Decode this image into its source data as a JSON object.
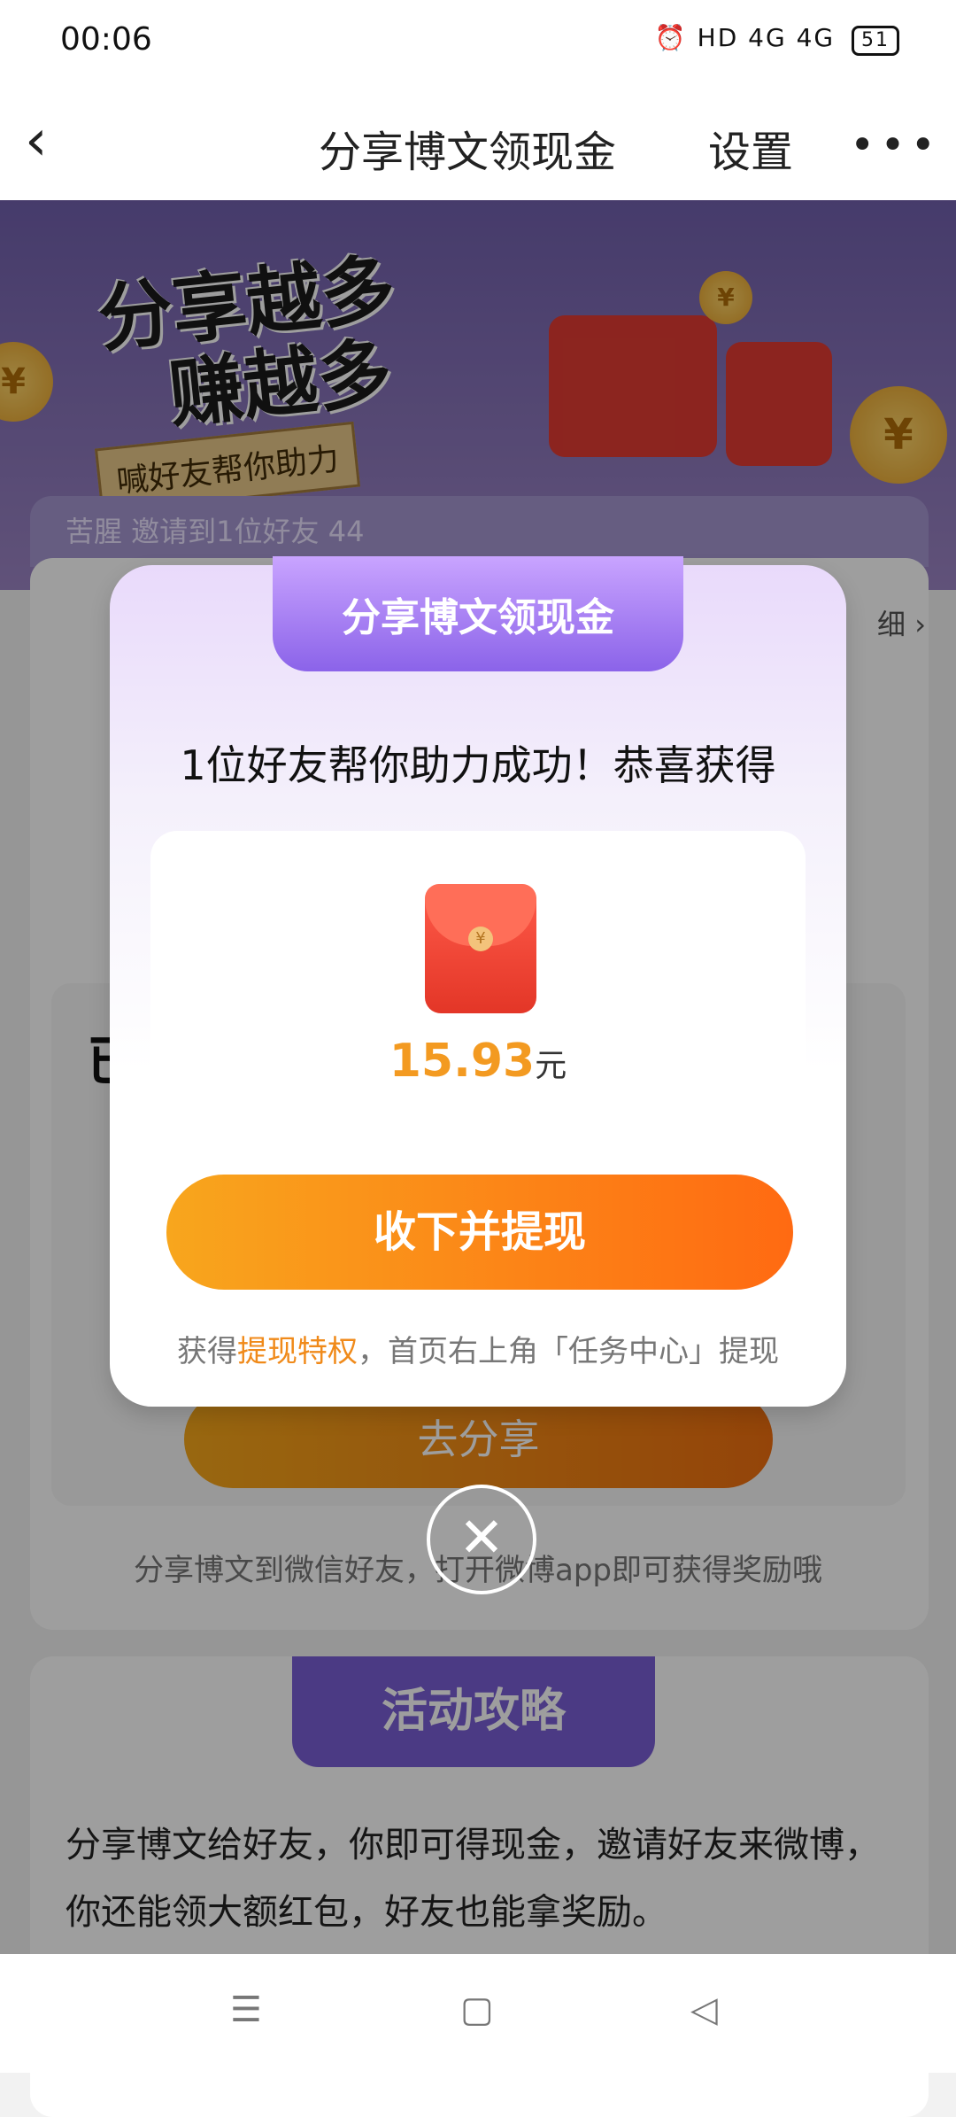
{
  "status": {
    "time": "00:06",
    "icons": "⏰ HD 4G 4G",
    "battery": "51"
  },
  "nav": {
    "back_icon": "‹",
    "title": "分享博文领现金",
    "settings_label": "设置",
    "more_icon": "•••"
  },
  "hero": {
    "headline1": "分享越多",
    "headline2": "赚越多",
    "tag": "喊好友帮你助力"
  },
  "progress_text": "苦腥 邀请到1位好友 44",
  "detail_link": "细 ›",
  "inner": {
    "char": "已",
    "share_button": "去分享"
  },
  "share_tip": "分享博文到微信好友，打开微博app即可获得奖励哦",
  "guide": {
    "title": "活动攻略",
    "text": "分享博文给好友，你即可得现金，邀请好友来微博，你还能领大额红包，好友也能拿奖励。"
  },
  "modal": {
    "banner_title": "分享博文领现金",
    "subtitle": "1位好友帮你助力成功！恭喜获得",
    "amount": "15.93",
    "unit": "元",
    "cta": "收下并提现",
    "note_prefix": "获得",
    "note_highlight": "提现特权",
    "note_suffix": "，首页右上角「任务中心」提现",
    "coin_symbol": "¥"
  },
  "close_icon": "✕",
  "bottom_nav": {
    "menu_icon": "☰",
    "home_icon": "▢",
    "back_icon": "◁"
  }
}
